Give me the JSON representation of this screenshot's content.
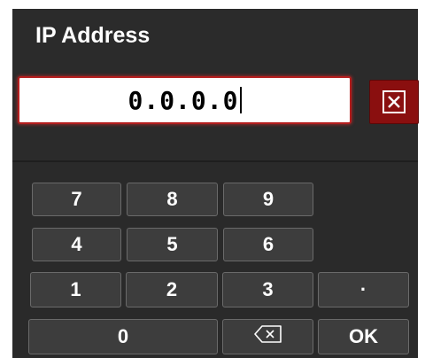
{
  "dialog": {
    "title": "IP Address",
    "input_value": "0.0.0.0",
    "clear_icon": "close-box-icon"
  },
  "keypad": {
    "k7": "7",
    "k8": "8",
    "k9": "9",
    "k4": "4",
    "k5": "5",
    "k6": "6",
    "k1": "1",
    "k2": "2",
    "k3": "3",
    "dot": "·",
    "k0": "0",
    "backspace_icon": "backspace-icon",
    "ok": "OK"
  },
  "colors": {
    "accent_red": "#b41e1e",
    "panel_bg": "#2a2a2a",
    "key_bg": "#3d3d3d"
  }
}
